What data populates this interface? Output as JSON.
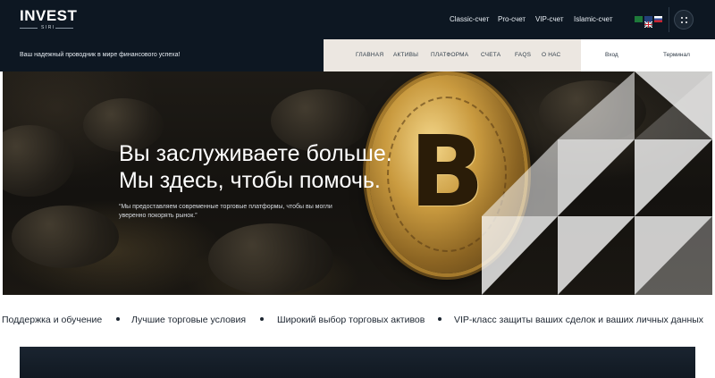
{
  "header": {
    "logo": {
      "main": "INVEST",
      "sub": "SIRI"
    },
    "accounts": [
      "Classic-счет",
      "Pro-счет",
      "VIP-счет",
      "Islamic-счет"
    ],
    "languages": [
      {
        "name": "arabic-flag",
        "color": "#1e7a3a"
      },
      {
        "name": "uk-flag",
        "color": "#24407a"
      },
      {
        "name": "russia-flag",
        "color": "#c9242f"
      }
    ],
    "menu_icon": "grid-dots-icon"
  },
  "subheader": {
    "tagline": "Ваш надежный проводник в мире финансового успеха!",
    "nav": [
      "ГЛАВНАЯ",
      "АКТИВЫ",
      "ПЛАТФОРМА",
      "СЧЕТА",
      "FAQS",
      "О НАС"
    ],
    "login": "Вход",
    "terminal": "Терминал"
  },
  "hero": {
    "title_line1": "Вы заслуживаете больше.",
    "title_line2": "Мы здесь, чтобы помочь.",
    "quote": "“Мы предоставляем современные торговые платформы, чтобы вы могли уверенно покорять рынок.”",
    "coin_symbol": "B"
  },
  "features": [
    "Поддержка и обучение",
    "Лучшие торговые условия",
    "Широкий выбор торговых активов",
    "VIP-класс защиты ваших сделок и ваших личных данных"
  ],
  "colors": {
    "header_bg": "#0d1722",
    "nav_bg": "#ece7e1",
    "text_dark": "#1c2530"
  }
}
